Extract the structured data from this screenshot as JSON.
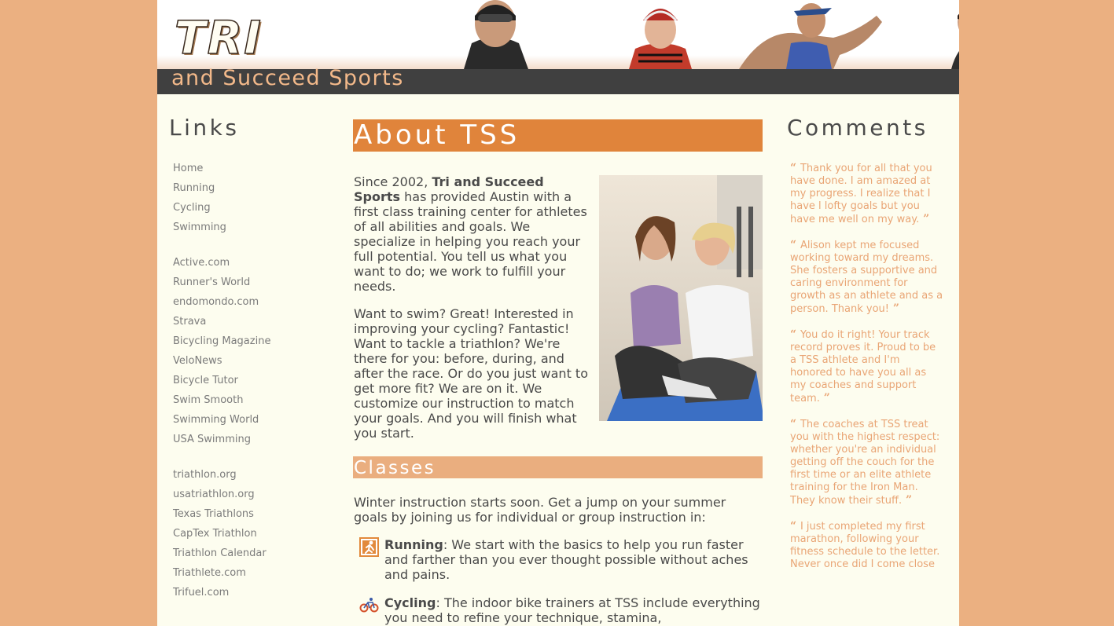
{
  "brand": {
    "logo_text": "TRI",
    "subtitle": "and Succeed Sports",
    "colors": {
      "page_bg": "#ebb081",
      "content_bg": "#fdfdef",
      "header_bar": "#404040",
      "accent": "#e0843b",
      "accent_light": "#eaae7f",
      "comment_text": "#e9a575"
    }
  },
  "links": {
    "heading": "Links",
    "groups": [
      [
        "Home",
        "Running",
        "Cycling",
        "Swimming"
      ],
      [
        "Active.com",
        "Runner's World",
        "endomondo.com",
        "Strava",
        "Bicycling Magazine",
        "VeloNews",
        "Bicycle Tutor",
        "Swim Smooth",
        "Swimming World",
        "USA Swimming"
      ],
      [
        "triathlon.org",
        "usatriathlon.org",
        "Texas Triathlons",
        "CapTex Triathlon",
        "Triathlon Calendar",
        "Triathlete.com",
        "Trifuel.com"
      ]
    ]
  },
  "about": {
    "heading": "About TSS",
    "p1_lead": "Since 2002, ",
    "p1_bold": "Tri and Succeed Sports",
    "p1_rest": " has provided Austin with a first class training center for athletes of all abilities and goals. We specialize in helping you reach your full potential. You tell us what you want to do; we work to fulfill your needs.",
    "p2": "Want to swim? Great! Interested in improving your cycling? Fantastic! Want to tackle a triathlon? We're there for you: before, during, and after the race. Or do you just want to get more fit? We are on it. We customize our instruction to match your goals. And you will finish what you start."
  },
  "classes": {
    "heading": "Classes",
    "intro": "Winter instruction starts soon. Get a jump on your summer goals by joining us for individual or group instruction in:",
    "items": [
      {
        "title": "Running",
        "text": ": We start with the basics to help you run faster and farther than you ever thought possible without aches and pains.",
        "icon": "running-icon"
      },
      {
        "title": "Cycling",
        "text": ": The indoor bike trainers at TSS include everything you need to refine your technique, stamina,",
        "icon": "cycling-icon"
      }
    ]
  },
  "comments": {
    "heading": "Comments",
    "items": [
      "Thank you for all that you have done. I am amazed at my progress. I realize that I have l lofty goals but you have me well on my way.",
      "Alison kept me focused working toward my dreams. She fosters a supportive and caring environment for growth as an athlete and as a person. Thank you!",
      "You do it right! Your track record proves it. Proud to be a TSS athlete and I'm honored to have you all as my coaches and support team.",
      "The coaches at TSS treat you with the highest respect: whether you're an individual getting off the couch for the first time or an elite athlete training for the Iron Man. They know their stuff.",
      "I just completed my first marathon, following your fitness schedule to the letter. Never once did I come close"
    ]
  }
}
